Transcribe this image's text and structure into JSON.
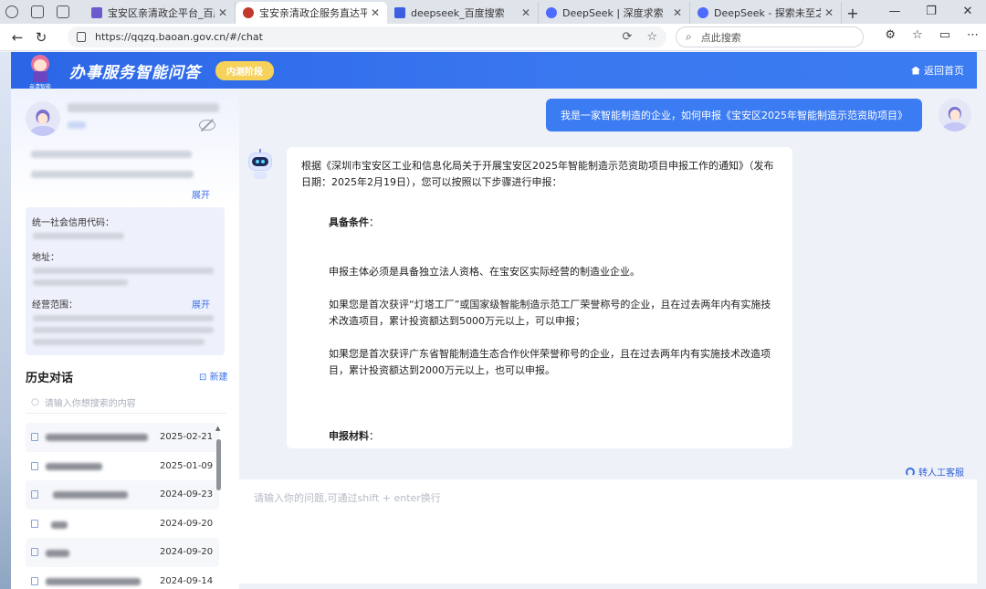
{
  "browser": {
    "tabs": [
      {
        "title": "宝安区亲清政企平台_百度搜索",
        "active": false,
        "favicon_color": "#6a5acd"
      },
      {
        "title": "宝安亲清政企服务直达平台",
        "active": true,
        "favicon_color": "#c0392b"
      },
      {
        "title": "deepseek_百度搜索",
        "active": false,
        "favicon_color": "#3b5fe0"
      },
      {
        "title": "DeepSeek | 深度求索",
        "active": false,
        "favicon_color": "#4d6bfe"
      },
      {
        "title": "DeepSeek - 探索未至之境",
        "active": false,
        "favicon_color": "#4d6bfe"
      }
    ],
    "url": "https://qqzq.baoan.gov.cn/#/chat",
    "search_placeholder": "点此搜索"
  },
  "header": {
    "logo_caption": "亲清智能",
    "title": "办事服务智能问答",
    "badge": "内测阶段",
    "home_link": "返回首页"
  },
  "sidebar": {
    "company": {
      "expand_label": "展开",
      "credit_code_label": "统一社会信用代码：",
      "address_label": "地址：",
      "scope_label": "经营范围：",
      "scope_expand_label": "展开"
    },
    "history": {
      "title": "历史对话",
      "new_label": "新建",
      "search_placeholder": "请输入你想搜索的内容",
      "items": [
        {
          "date": "2025-02-21"
        },
        {
          "date": "2025-01-09"
        },
        {
          "date": "2024-09-23"
        },
        {
          "date": "2024-09-20"
        },
        {
          "date": "2024-09-20"
        },
        {
          "date": "2024-09-14"
        }
      ]
    }
  },
  "chat": {
    "user_message": "我是一家智能制造的企业，如何申报《宝安区2025年智能制造示范资助项目》",
    "bot": {
      "intro": "根据《深圳市宝安区工业和信息化局关于开展宝安区2025年智能制造示范资助项目申报工作的通知》（发布日期：2025年2月19日），您可以按照以下步骤进行申报：",
      "conditions_heading": "具备条件",
      "colon": "：",
      "para1": "申报主体必须是具备独立法人资格、在宝安区实际经营的制造业企业。",
      "para2": "如果您是首次获评“灯塔工厂”或国家级智能制造示范工厂荣誉称号的企业，且在过去两年内有实施技术改造项目，累计投资额达到5000万元以上，可以申报；",
      "para3": "如果您是首次获评广东省智能制造生态合作伙伴荣誉称号的企业，且在过去两年内有实施技术改造项目，累计投资额达到2000万元以上，也可以申报。",
      "materials_heading": "申报材料"
    },
    "transfer_label": "转人工客服",
    "input_placeholder": "请输入你的问题,可通过shift + enter换行"
  },
  "colors": {
    "brand_blue": "#3c7cf2",
    "badge_yellow": "#f6d25a",
    "link_blue": "#3b6fe6"
  }
}
